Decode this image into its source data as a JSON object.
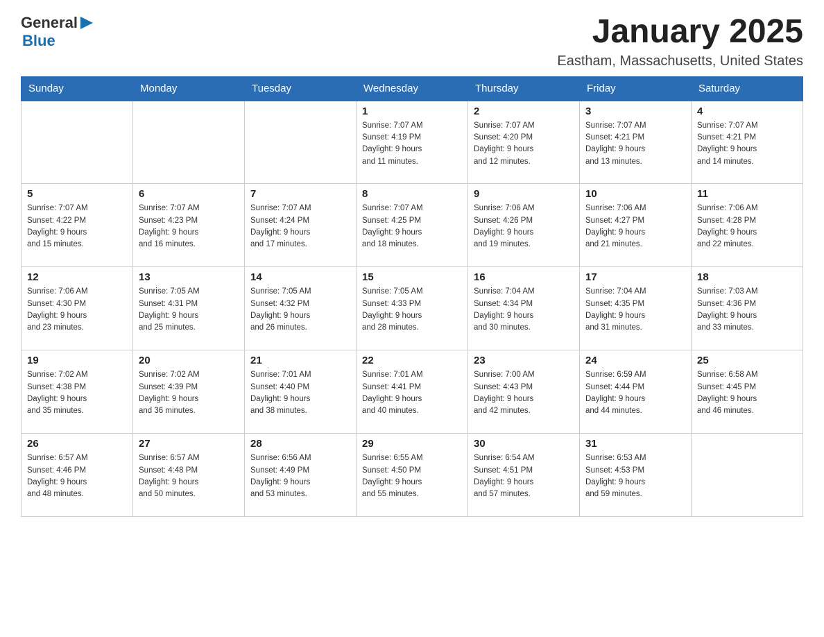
{
  "header": {
    "logo_general": "General",
    "logo_blue": "Blue",
    "month_title": "January 2025",
    "location": "Eastham, Massachusetts, United States"
  },
  "days_of_week": [
    "Sunday",
    "Monday",
    "Tuesday",
    "Wednesday",
    "Thursday",
    "Friday",
    "Saturday"
  ],
  "weeks": [
    [
      {
        "day": "",
        "info": ""
      },
      {
        "day": "",
        "info": ""
      },
      {
        "day": "",
        "info": ""
      },
      {
        "day": "1",
        "info": "Sunrise: 7:07 AM\nSunset: 4:19 PM\nDaylight: 9 hours\nand 11 minutes."
      },
      {
        "day": "2",
        "info": "Sunrise: 7:07 AM\nSunset: 4:20 PM\nDaylight: 9 hours\nand 12 minutes."
      },
      {
        "day": "3",
        "info": "Sunrise: 7:07 AM\nSunset: 4:21 PM\nDaylight: 9 hours\nand 13 minutes."
      },
      {
        "day": "4",
        "info": "Sunrise: 7:07 AM\nSunset: 4:21 PM\nDaylight: 9 hours\nand 14 minutes."
      }
    ],
    [
      {
        "day": "5",
        "info": "Sunrise: 7:07 AM\nSunset: 4:22 PM\nDaylight: 9 hours\nand 15 minutes."
      },
      {
        "day": "6",
        "info": "Sunrise: 7:07 AM\nSunset: 4:23 PM\nDaylight: 9 hours\nand 16 minutes."
      },
      {
        "day": "7",
        "info": "Sunrise: 7:07 AM\nSunset: 4:24 PM\nDaylight: 9 hours\nand 17 minutes."
      },
      {
        "day": "8",
        "info": "Sunrise: 7:07 AM\nSunset: 4:25 PM\nDaylight: 9 hours\nand 18 minutes."
      },
      {
        "day": "9",
        "info": "Sunrise: 7:06 AM\nSunset: 4:26 PM\nDaylight: 9 hours\nand 19 minutes."
      },
      {
        "day": "10",
        "info": "Sunrise: 7:06 AM\nSunset: 4:27 PM\nDaylight: 9 hours\nand 21 minutes."
      },
      {
        "day": "11",
        "info": "Sunrise: 7:06 AM\nSunset: 4:28 PM\nDaylight: 9 hours\nand 22 minutes."
      }
    ],
    [
      {
        "day": "12",
        "info": "Sunrise: 7:06 AM\nSunset: 4:30 PM\nDaylight: 9 hours\nand 23 minutes."
      },
      {
        "day": "13",
        "info": "Sunrise: 7:05 AM\nSunset: 4:31 PM\nDaylight: 9 hours\nand 25 minutes."
      },
      {
        "day": "14",
        "info": "Sunrise: 7:05 AM\nSunset: 4:32 PM\nDaylight: 9 hours\nand 26 minutes."
      },
      {
        "day": "15",
        "info": "Sunrise: 7:05 AM\nSunset: 4:33 PM\nDaylight: 9 hours\nand 28 minutes."
      },
      {
        "day": "16",
        "info": "Sunrise: 7:04 AM\nSunset: 4:34 PM\nDaylight: 9 hours\nand 30 minutes."
      },
      {
        "day": "17",
        "info": "Sunrise: 7:04 AM\nSunset: 4:35 PM\nDaylight: 9 hours\nand 31 minutes."
      },
      {
        "day": "18",
        "info": "Sunrise: 7:03 AM\nSunset: 4:36 PM\nDaylight: 9 hours\nand 33 minutes."
      }
    ],
    [
      {
        "day": "19",
        "info": "Sunrise: 7:02 AM\nSunset: 4:38 PM\nDaylight: 9 hours\nand 35 minutes."
      },
      {
        "day": "20",
        "info": "Sunrise: 7:02 AM\nSunset: 4:39 PM\nDaylight: 9 hours\nand 36 minutes."
      },
      {
        "day": "21",
        "info": "Sunrise: 7:01 AM\nSunset: 4:40 PM\nDaylight: 9 hours\nand 38 minutes."
      },
      {
        "day": "22",
        "info": "Sunrise: 7:01 AM\nSunset: 4:41 PM\nDaylight: 9 hours\nand 40 minutes."
      },
      {
        "day": "23",
        "info": "Sunrise: 7:00 AM\nSunset: 4:43 PM\nDaylight: 9 hours\nand 42 minutes."
      },
      {
        "day": "24",
        "info": "Sunrise: 6:59 AM\nSunset: 4:44 PM\nDaylight: 9 hours\nand 44 minutes."
      },
      {
        "day": "25",
        "info": "Sunrise: 6:58 AM\nSunset: 4:45 PM\nDaylight: 9 hours\nand 46 minutes."
      }
    ],
    [
      {
        "day": "26",
        "info": "Sunrise: 6:57 AM\nSunset: 4:46 PM\nDaylight: 9 hours\nand 48 minutes."
      },
      {
        "day": "27",
        "info": "Sunrise: 6:57 AM\nSunset: 4:48 PM\nDaylight: 9 hours\nand 50 minutes."
      },
      {
        "day": "28",
        "info": "Sunrise: 6:56 AM\nSunset: 4:49 PM\nDaylight: 9 hours\nand 53 minutes."
      },
      {
        "day": "29",
        "info": "Sunrise: 6:55 AM\nSunset: 4:50 PM\nDaylight: 9 hours\nand 55 minutes."
      },
      {
        "day": "30",
        "info": "Sunrise: 6:54 AM\nSunset: 4:51 PM\nDaylight: 9 hours\nand 57 minutes."
      },
      {
        "day": "31",
        "info": "Sunrise: 6:53 AM\nSunset: 4:53 PM\nDaylight: 9 hours\nand 59 minutes."
      },
      {
        "day": "",
        "info": ""
      }
    ]
  ]
}
